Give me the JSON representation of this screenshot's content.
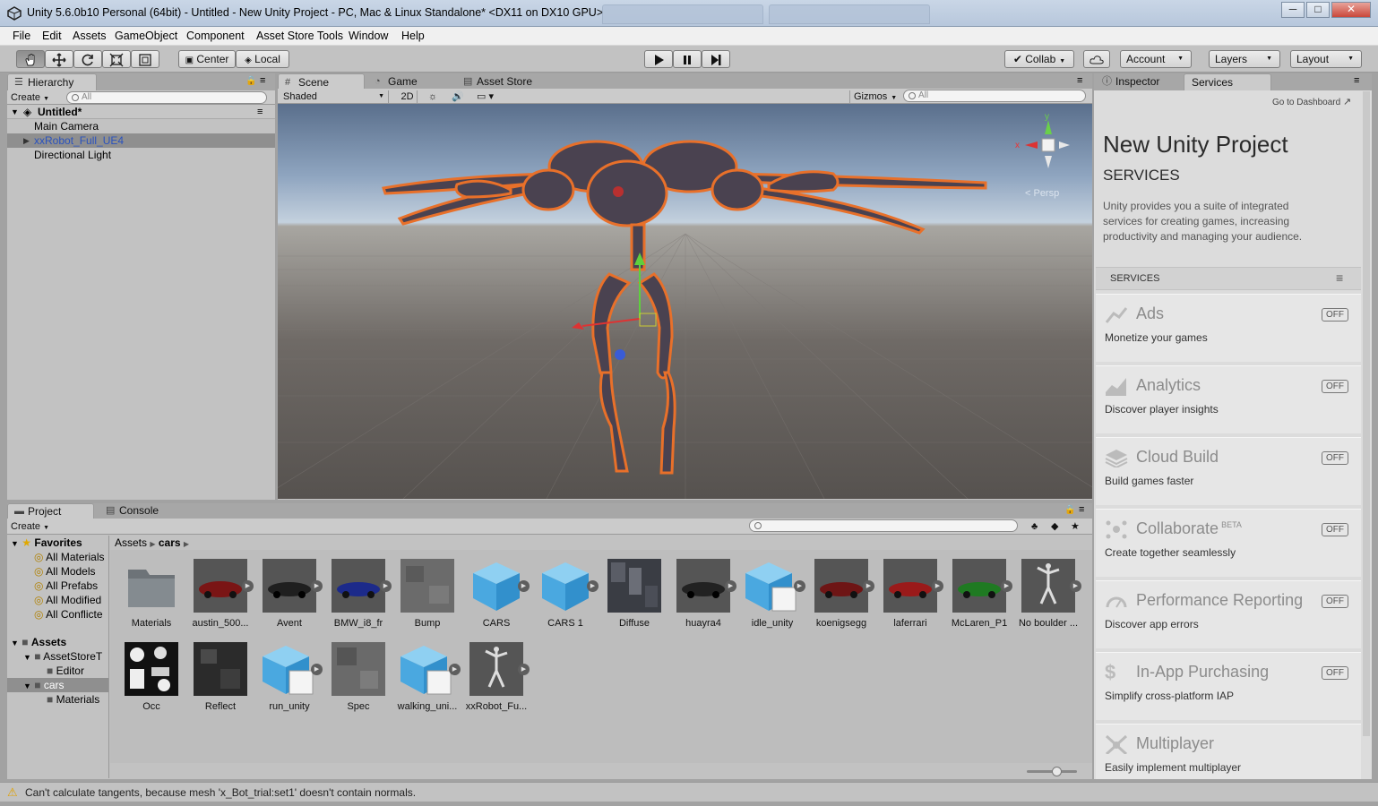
{
  "window": {
    "title": "Unity 5.6.0b10 Personal (64bit) - Untitled - New Unity Project - PC, Mac & Linux Standalone* <DX11 on DX10 GPU>",
    "controls": [
      "─",
      "□",
      "✕"
    ]
  },
  "menu": [
    "File",
    "Edit",
    "Assets",
    "GameObject",
    "Component",
    "Asset Store Tools",
    "Window",
    "Help"
  ],
  "toolbar": {
    "tools": [
      "hand-tool",
      "move-tool",
      "rotate-tool",
      "scale-tool",
      "rect-tool"
    ],
    "pivot": "Center",
    "space": "Local",
    "collab": "Collab",
    "account": "Account",
    "layers": "Layers",
    "layout": "Layout"
  },
  "hierarchy": {
    "tab": "Hierarchy",
    "create": "Create",
    "search_placeholder": "All",
    "scene": "Untitled*",
    "items": [
      "Main Camera",
      "xxRobot_Full_UE4",
      "Directional Light"
    ]
  },
  "scene": {
    "tabs": [
      "Scene",
      "Game",
      "Asset Store"
    ],
    "shading": "Shaded",
    "mode2d": "2D",
    "gizmos": "Gizmos",
    "search_placeholder": "All",
    "persp": "< Persp",
    "axes": {
      "x": "x",
      "y": "y"
    }
  },
  "project": {
    "tabs": [
      "Project",
      "Console"
    ],
    "create": "Create",
    "favorites": {
      "label": "Favorites",
      "items": [
        "All Materials",
        "All Models",
        "All Prefabs",
        "All Modified",
        "All Conflicte"
      ]
    },
    "tree": {
      "assets": "Assets",
      "children": [
        "AssetStoreT",
        "Editor",
        "cars",
        "Materials"
      ]
    },
    "breadcrumb": [
      "Assets",
      "cars"
    ],
    "assets_row1": [
      "Materials",
      "austin_500...",
      "Avent",
      "BMW_i8_fr",
      "Bump",
      "CARS",
      "CARS 1",
      "Diffuse",
      "huayra4",
      "idle_unity",
      "koenigsegg",
      "laferrari",
      "McLaren_P1",
      "No boulder ..."
    ],
    "assets_row2": [
      "Occ",
      "Reflect",
      "run_unity",
      "Spec",
      "walking_uni...",
      "xxRobot_Fu..."
    ]
  },
  "services": {
    "tabs": [
      "Inspector",
      "Services"
    ],
    "dashboard": "Go to Dashboard",
    "project_name": "New Unity Project",
    "heading": "SERVICES",
    "intro": "Unity provides you a suite of integrated services for creating games, increasing productivity and managing your audience.",
    "section": "SERVICES",
    "items": [
      {
        "name": "Ads",
        "desc": "Monetize your games",
        "state": "OFF"
      },
      {
        "name": "Analytics",
        "desc": "Discover player insights",
        "state": "OFF"
      },
      {
        "name": "Cloud Build",
        "desc": "Build games faster",
        "state": "OFF"
      },
      {
        "name": "Collaborate",
        "badge": "BETA",
        "desc": "Create together seamlessly",
        "state": "OFF"
      },
      {
        "name": "Performance Reporting",
        "desc": "Discover app errors",
        "state": "OFF"
      },
      {
        "name": "In-App Purchasing",
        "desc": "Simplify cross-platform IAP",
        "state": "OFF"
      },
      {
        "name": "Multiplayer",
        "desc": "Easily implement multiplayer"
      }
    ]
  },
  "status": {
    "message": "Can't calculate tangents, because mesh 'x_Bot_trial:set1' doesn't contain normals."
  }
}
